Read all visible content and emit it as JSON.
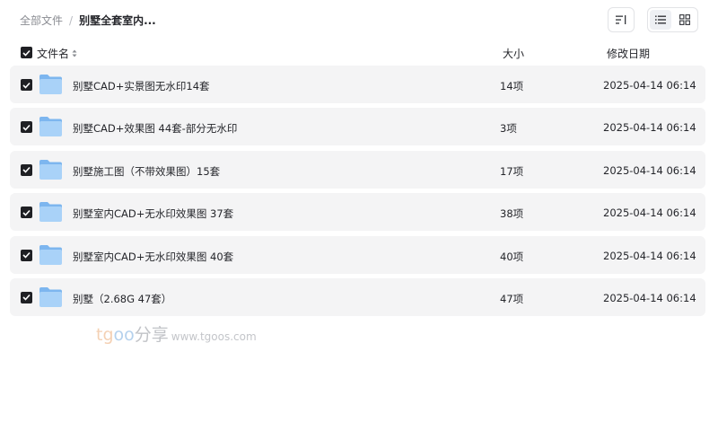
{
  "breadcrumb": {
    "root": "全部文件",
    "separator": "/",
    "current": "别墅全套室内..."
  },
  "toolbar": {
    "sort_icon": "sort-lines-icon",
    "list_view_icon": "list-view-icon",
    "grid_view_icon": "grid-view-icon",
    "active_view": "list"
  },
  "columns": {
    "name": "文件名",
    "size": "大小",
    "date": "修改日期"
  },
  "files": [
    {
      "name": "别墅CAD+实景图无水印14套",
      "size": "14项",
      "date": "2025-04-14 06:14",
      "checked": true
    },
    {
      "name": "别墅CAD+效果图 44套-部分无水印",
      "size": "3项",
      "date": "2025-04-14 06:14",
      "checked": true
    },
    {
      "name": "别墅施工图（不带效果图）15套",
      "size": "17项",
      "date": "2025-04-14 06:14",
      "checked": true
    },
    {
      "name": "别墅室内CAD+无水印效果图 37套",
      "size": "38项",
      "date": "2025-04-14 06:14",
      "checked": true
    },
    {
      "name": "别墅室内CAD+无水印效果图 40套",
      "size": "40项",
      "date": "2025-04-14 06:14",
      "checked": true
    },
    {
      "name": "别墅（2.68G 47套）",
      "size": "47项",
      "date": "2025-04-14 06:14",
      "checked": true
    }
  ],
  "watermark": {
    "part1": "tg",
    "part2": "oo",
    "part3": "分享",
    "url": "www.tgoos.com"
  },
  "colors": {
    "folder_light": "#a9d2f8",
    "folder_dark": "#7db6ef",
    "checkbox": "#1f2024",
    "row_bg": "#f4f4f5"
  }
}
